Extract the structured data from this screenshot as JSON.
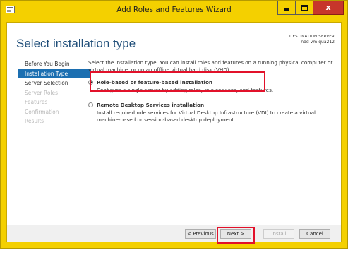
{
  "window": {
    "title": "Add Roles and Features Wizard",
    "minimize": "–",
    "maximize": "□",
    "close": "x"
  },
  "page": {
    "title": "Select installation type",
    "destination_label": "DESTINATION SERVER",
    "destination_server": "ndd-vm-qua212"
  },
  "nav": {
    "items": [
      {
        "label": "Before You Begin"
      },
      {
        "label": "Installation Type"
      },
      {
        "label": "Server Selection"
      },
      {
        "label": "Server Roles"
      },
      {
        "label": "Features"
      },
      {
        "label": "Confirmation"
      },
      {
        "label": "Results"
      }
    ]
  },
  "content": {
    "description": "Select the installation type. You can install roles and features on a running physical computer or virtual machine, or on an offline virtual hard disk (VHD).",
    "options": [
      {
        "title": "Role-based or feature-based installation",
        "description": "Configure a single server by adding roles, role services, and features.",
        "selected": true
      },
      {
        "title": "Remote Desktop Services installation",
        "description": "Install required role services for Virtual Desktop Infrastructure (VDI) to create a virtual machine-based or session-based desktop deployment.",
        "selected": false
      }
    ]
  },
  "footer": {
    "previous": "< Previous",
    "next": "Next >",
    "install": "Install",
    "cancel": "Cancel"
  },
  "colors": {
    "frame": "#f4d000",
    "accent": "#1c6fb1",
    "highlight": "#e2112a",
    "title_blue": "#1f4e79"
  },
  "icons": {
    "app": "server-manager-icon",
    "minimize": "minimize-icon",
    "maximize": "maximize-icon",
    "close": "close-icon"
  }
}
